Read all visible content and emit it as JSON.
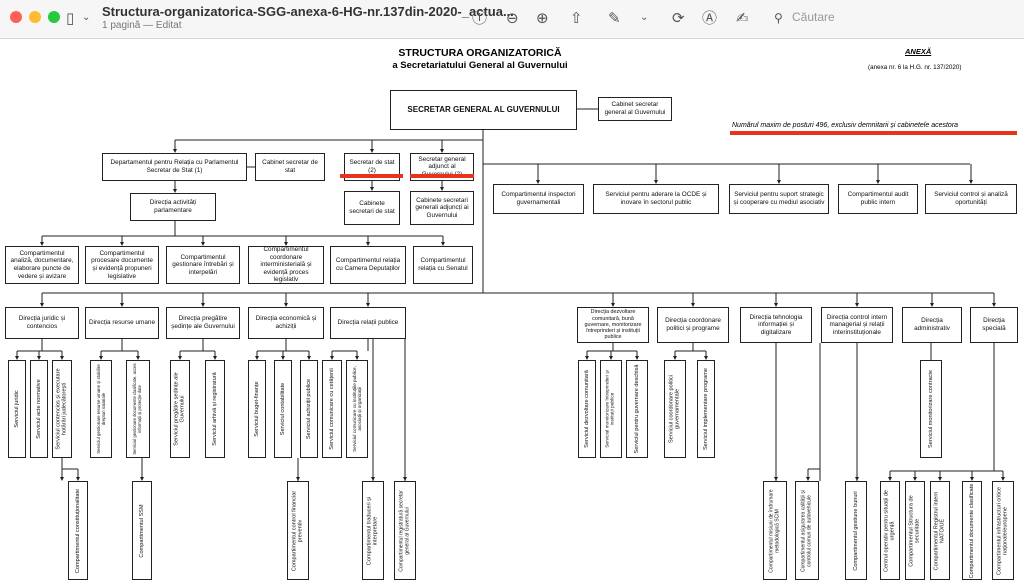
{
  "window": {
    "title": "Structura-organizatorica-SGG-anexa-6-HG-nr.137din-2020-_actua...",
    "subtitle": "1 pagină — Editat",
    "search_placeholder": "Căutare"
  },
  "colors": {
    "annotation_red": "#e8341c",
    "close": "#ff5f57",
    "minimize": "#febc2e",
    "zoom": "#28c840"
  },
  "toolbar_icons": [
    "sidebar-icon",
    "chevron-down-icon",
    "info-icon",
    "zoom-out-icon",
    "zoom-in-icon",
    "share-icon",
    "markup-pen-icon",
    "chevron-down-icon",
    "rotate-icon",
    "markup-circle-icon",
    "signature-icon",
    "search-icon"
  ],
  "doc": {
    "title1": "STRUCTURA ORGANIZATORICĂ",
    "title2": "a Secretariatului General al Guvernului",
    "anexa": "ANEXĂ",
    "anexa_sub": "(anexa nr. 6 la H.G. nr. 137/2020)",
    "note": "Numărul maxim de posturi 496, exclusiv demnitarii și cabinetele acestora"
  },
  "boxes": {
    "sg": "SECRETAR GENERAL AL GUVERNULUI",
    "cab_sg": "Cabinet secretar general al Guvernului",
    "dep": "Departamentul pentru Relația cu Parlamentul Secretar de Stat (1)",
    "cab_ss": "Cabinet secretar de stat",
    "ss": "Secretar de stat (2)",
    "sga": "Secretar general adjunct al Guvernului (2)",
    "cab_ss2": "Cabinete secretari de stat",
    "cab_sga": "Cabinete secretari generali adjuncți ai Guvernului",
    "dap": "Direcția activități parlamentare",
    "p1": "Compartimentul inspectori guvernamentali",
    "p2": "Serviciul pentru aderare la OCDE și inovare în sectorul public",
    "p3": "Serviciul pentru suport strategic și cooperare cu mediul asociativ",
    "p4": "Compartimentul audit public intern",
    "p5": "Serviciul control și analiză oportunități",
    "c1": "Compartimentul analiză, documentare, elaborare puncte de vedere și avizare",
    "c2": "Compartimentul procesare documente și evidență propuneri legislative",
    "c3": "Compartimentul gestionare întrebări și interpelări",
    "c4": "Compartimentul coordonare interministerială și evidență proces legislativ",
    "c5": "Compartimentul relația cu Camera Deputaților",
    "c6": "Compartimentul relația cu Senatul",
    "d1": "Direcția juridic și contencios",
    "d2": "Direcția resurse umane",
    "d3": "Direcția pregătire ședințe ale Guvernului",
    "d4": "Direcția economică și achiziții",
    "d5": "Direcția relații publice",
    "d6": "Direcția dezvoltare comunitară, bună guvernare, monitorizare întreprinderi și instituții publice",
    "d7": "Direcția coordonare politici și programe",
    "d8": "Direcția tehnologia informației și digitalizare",
    "d9": "Direcția control intern managerial și relații interinstituționale",
    "d10": "Direcția administrativ",
    "d11": "Direcția specială"
  },
  "vboxes": {
    "v1": "Serviciul juridic",
    "v2": "Serviciul acte normative",
    "v3": "Serviciul contencios și executare hotărâri judecătorești",
    "v4": "Serviciul gestionare resurse umane și stabilire drepturi salariale",
    "v5": "Serviciul gestionare documente clasificate, acces informații și protecție date",
    "v6": "Serviciul pregătire ședințe ale Guvernului",
    "v7": "Serviciul arhivă și registratură",
    "v8": "Serviciul buget-finanțe",
    "v9": "Serviciul contabilitate",
    "v10": "Serviciul achiziții publice",
    "v11": "Serviciul comunicare cu cetățenii",
    "v12": "Serviciul comunicare cu instituțiile publice, asociații și organizații",
    "v13": "Serviciul dezvoltare comunitară",
    "v14": "Serviciul monitorizare întreprinderi și instituții publice",
    "v15": "Serviciul pentru guvernare deschisă",
    "v16": "Serviciul coordonare politici guvernamentale",
    "v17": "Serviciul implementare programe",
    "v18": "Serviciul monitorizare contracte",
    "w1": "Compartimentul constituționalitate",
    "w2": "Compartimentul SSM",
    "w3": "Compartimentul control financiar preventiv",
    "w4": "Compartimentul traduceri și interpretare",
    "w5": "Compartimentul registratură secretar general al Guvernului",
    "w6": "Compartimentul misiuni de îndrumare metodologică SCIM",
    "w7": "Compartimentul asigurarea calității și controlul comun de autovehicule",
    "w8": "Compartimentul gestiune bunuri",
    "w9": "Centrul operativ pentru situații de urgență",
    "w10": "Compartimentul Structura de securitate",
    "w11": "Compartimentul Registrul intern NATO/UE",
    "w12": "Compartimentul documente clasificate",
    "w13": "Compartimentul infrastructuri critice naționale/europene"
  }
}
